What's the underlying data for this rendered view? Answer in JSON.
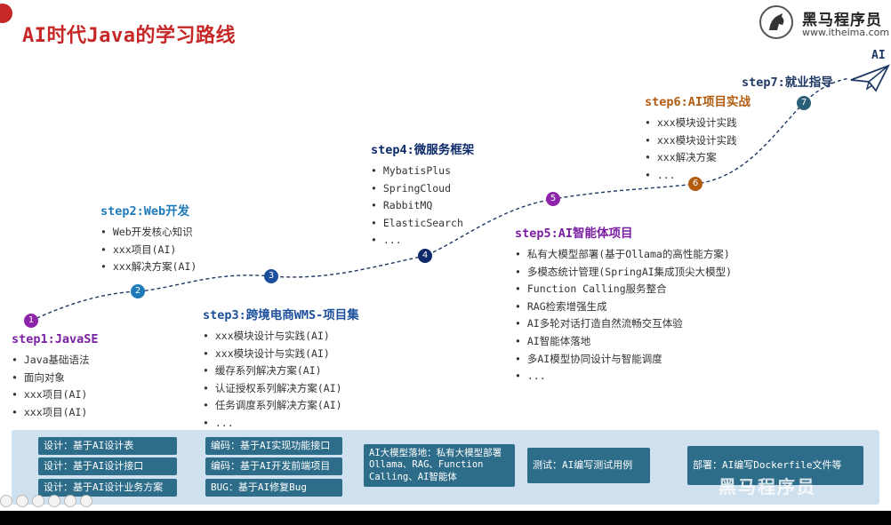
{
  "slide": {
    "title": "AI时代Java的学习路线",
    "logo": {
      "name": "黑马程序员",
      "url": "www.itheima.com"
    },
    "ai_label": "AI"
  },
  "colors": {
    "title": "#c62828",
    "node1": "#8e24aa",
    "node2": "#1e7ab8",
    "node3": "#1b4f9c",
    "node4": "#0e2a6b",
    "node5": "#8e24aa",
    "node6": "#b35c10",
    "node7": "#2b5f78",
    "panel_bg": "#cfe0ef",
    "box_bg": "#2e6d8a"
  },
  "nodes": [
    "1",
    "2",
    "3",
    "4",
    "5",
    "6",
    "7"
  ],
  "steps": [
    {
      "title": "step1:JavaSE",
      "items": [
        "Java基础语法",
        "面向对象",
        "xxx项目(AI)",
        "xxx项目(AI)"
      ]
    },
    {
      "title": "step2:Web开发",
      "items": [
        "Web开发核心知识",
        "xxx项目(AI)",
        "xxx解决方案(AI)"
      ]
    },
    {
      "title": "step3:跨境电商WMS-项目集",
      "items": [
        "xxx模块设计与实践(AI)",
        "xxx模块设计与实践(AI)",
        "缓存系列解决方案(AI)",
        "认证授权系列解决方案(AI)",
        "任务调度系列解决方案(AI)",
        "..."
      ]
    },
    {
      "title": "step4:微服务框架",
      "items": [
        "MybatisPlus",
        "SpringCloud",
        "RabbitMQ",
        "ElasticSearch",
        "..."
      ]
    },
    {
      "title": "step5:AI智能体项目",
      "items": [
        "私有大模型部署(基于Ollama的高性能方案)",
        "多模态统计管理(SpringAI集成顶尖大模型)",
        "Function Calling服务整合",
        "RAG检索增强生成",
        "AI多轮对话打造自然流畅交互体验",
        "AI智能体落地",
        "多AI模型协同设计与智能调度",
        "..."
      ]
    },
    {
      "title": "step6:AI项目实战",
      "items": [
        "xxx模块设计实践",
        "xxx模块设计实践",
        "xxx解决方案",
        "..."
      ]
    },
    {
      "title": "step7:就业指导",
      "items": []
    }
  ],
  "bottom": {
    "col1": [
      "设计：基于AI设计表",
      "设计：基于AI设计接口",
      "设计：基于AI设计业务方案"
    ],
    "col2": [
      "编码：基于AI实现功能接口",
      "编码：基于AI开发前端项目",
      "BUG：基于AI修复Bug"
    ],
    "col3": "AI大模型落地：私有大模型部署Ollama、RAG、Function Calling、AI智能体",
    "col4": "测试：AI编写测试用例",
    "col5": "部署：AI编写Dockerfile文件等",
    "watermark": "黑马程序员"
  }
}
